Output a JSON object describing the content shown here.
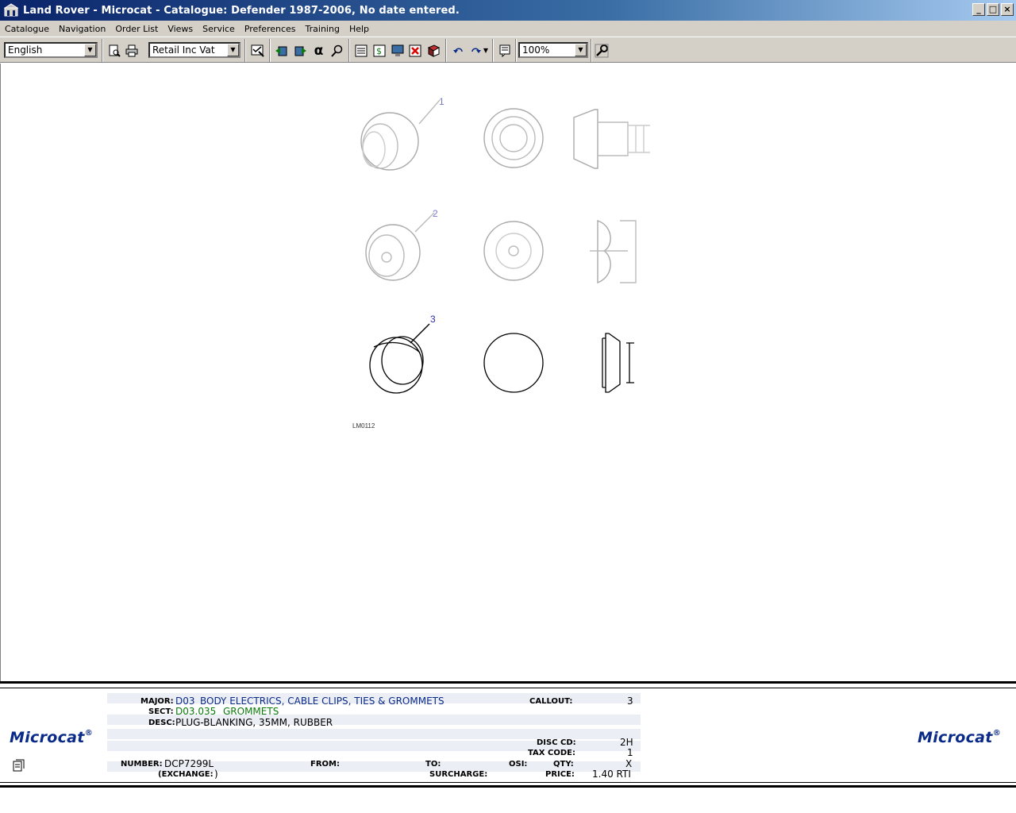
{
  "window": {
    "title": "Land Rover - Microcat - Catalogue: Defender 1987-2006, No date entered."
  },
  "menu": [
    "Catalogue",
    "Navigation",
    "Order List",
    "Views",
    "Service",
    "Preferences",
    "Training",
    "Help"
  ],
  "toolbar": {
    "language": "English",
    "price_mode": "Retail Inc Vat",
    "zoom": "100%",
    "alpha_glyph": "α"
  },
  "drawing": {
    "callouts": [
      "1",
      "2",
      "3"
    ],
    "reference": "LM0112"
  },
  "info": {
    "brand": "Microcat",
    "brand_mark": "®",
    "major_label": "MAJOR:",
    "major_code": "D03",
    "major_desc": "BODY ELECTRICS, CABLE CLIPS, TIES & GROMMETS",
    "sect_label": "SECT:",
    "sect_code": "D03.035",
    "sect_desc": "GROMMETS",
    "desc_label": "DESC:",
    "desc_value": "PLUG-BLANKING, 35MM, RUBBER",
    "callout_label": "CALLOUT:",
    "callout_value": "3",
    "disc_label": "DISC CD:",
    "disc_value": "2H",
    "tax_label": "TAX CODE:",
    "tax_value": "1",
    "number_label": "NUMBER:",
    "number_value": "DCP7299L",
    "from_label": "FROM:",
    "to_label": "TO:",
    "osi_label": "OSI:",
    "qty_label": "QTY:",
    "qty_value": "X",
    "exchange_label": "(EXCHANGE:",
    "exchange_value": ")",
    "surcharge_label": "SURCHARGE:",
    "price_label": "PRICE:",
    "price_value": "1.40 RTI"
  },
  "colors": {
    "title_gradient_start": "#0a246a",
    "brand": "#0a2a88",
    "section": "#0a7a0a"
  }
}
